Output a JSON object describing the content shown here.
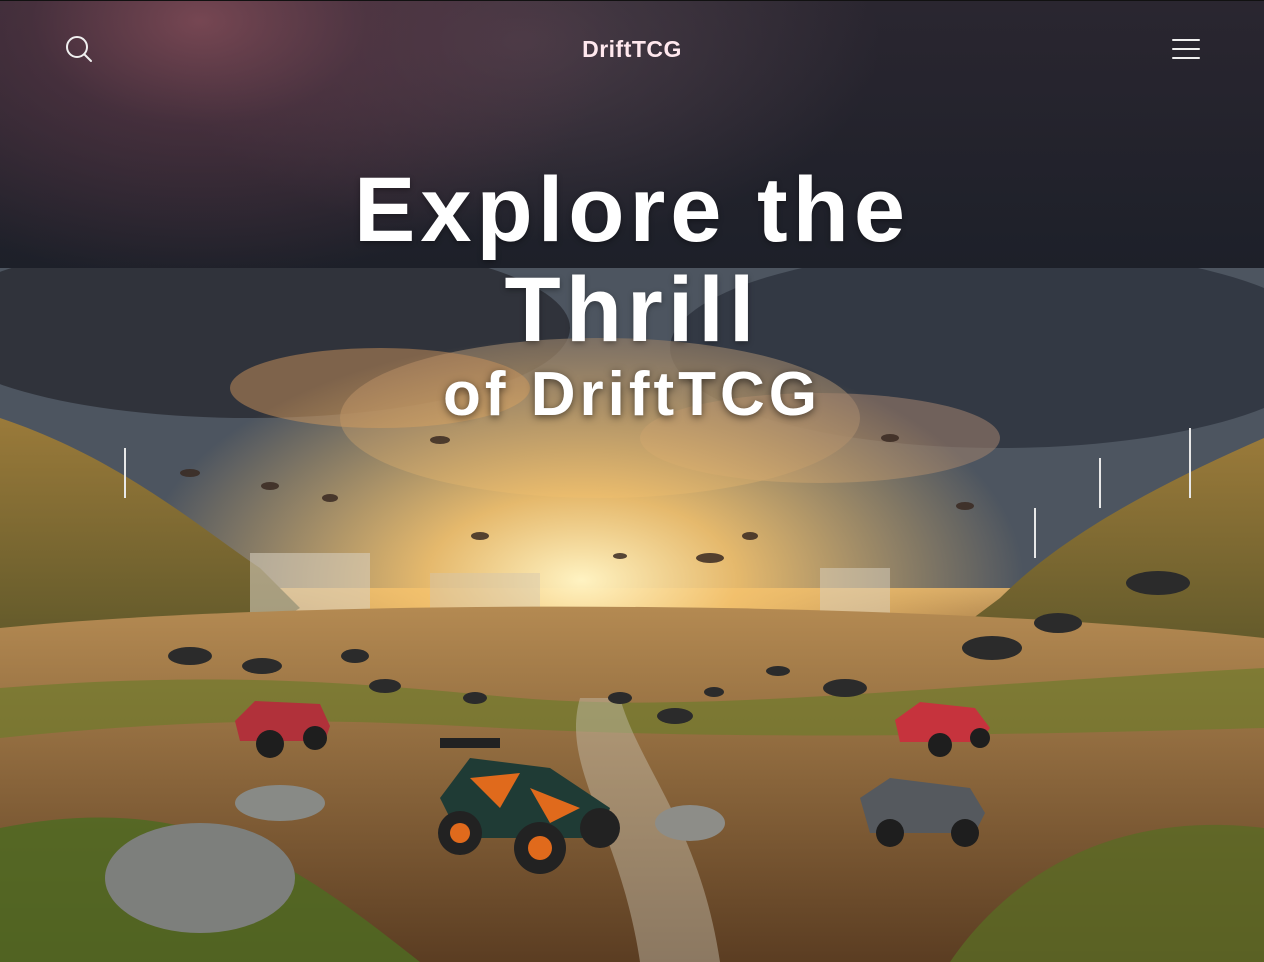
{
  "header": {
    "brand": "DriftTCG",
    "search_icon": "search-icon",
    "menu_icon": "hamburger-menu-icon"
  },
  "hero": {
    "title": "Explore the Thrill",
    "subtitle": "of DriftTCG"
  },
  "colors": {
    "brand_text": "#ffe8ee",
    "hero_text": "#ffffff",
    "top_band": "#1d2029"
  }
}
